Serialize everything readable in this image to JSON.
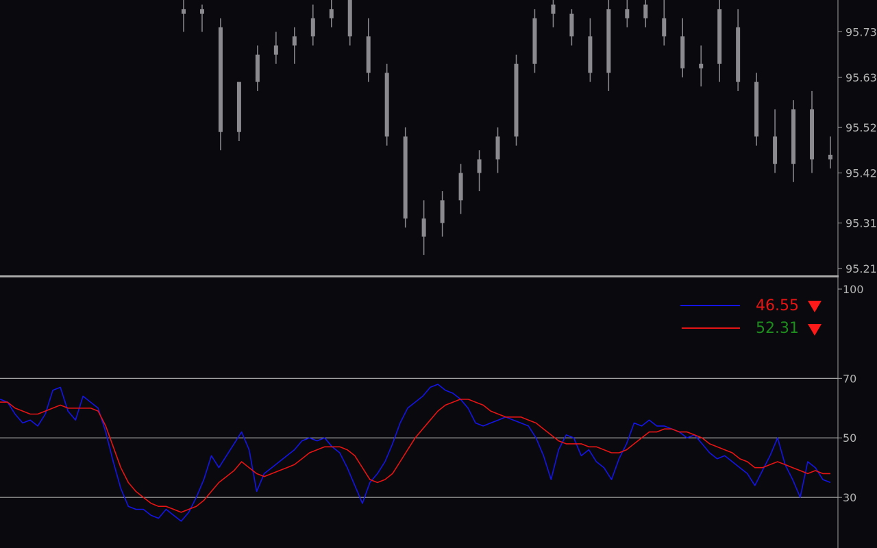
{
  "colors": {
    "background": "#0a0a0e",
    "axis_text": "#b4b4b4",
    "candle": "#8a8a8f",
    "level_line": "#a3a3a3",
    "separator": "#a9a9a9",
    "main_line": "#1414e6",
    "signal_line": "#e61414",
    "value_red": "#e61414",
    "value_green": "#1e8c1e",
    "arrow_red": "#ff1a1a"
  },
  "chart_data": [
    {
      "type": "candlestick",
      "title": "",
      "y_axis_side": "right",
      "ylim": [
        95.195,
        95.8
      ],
      "y_ticks": [
        "95.73",
        "95.63",
        "95.52",
        "95.42",
        "95.31",
        "95.21"
      ],
      "y_tick_values": [
        95.73,
        95.63,
        95.52,
        95.42,
        95.31,
        95.21
      ],
      "candles": [
        {
          "o": 95.78,
          "h": 95.8,
          "l": 95.73,
          "c": 95.77
        },
        {
          "o": 95.77,
          "h": 95.79,
          "l": 95.73,
          "c": 95.78
        },
        {
          "o": 95.74,
          "h": 95.76,
          "l": 95.47,
          "c": 95.51
        },
        {
          "o": 95.51,
          "h": 95.58,
          "l": 95.49,
          "c": 95.62
        },
        {
          "o": 95.62,
          "h": 95.7,
          "l": 95.6,
          "c": 95.68
        },
        {
          "o": 95.68,
          "h": 95.73,
          "l": 95.66,
          "c": 95.7
        },
        {
          "o": 95.7,
          "h": 95.74,
          "l": 95.66,
          "c": 95.72
        },
        {
          "o": 95.72,
          "h": 95.79,
          "l": 95.7,
          "c": 95.76
        },
        {
          "o": 95.76,
          "h": 95.8,
          "l": 95.74,
          "c": 95.78
        },
        {
          "o": 95.8,
          "h": 95.8,
          "l": 95.7,
          "c": 95.72
        },
        {
          "o": 95.72,
          "h": 95.76,
          "l": 95.62,
          "c": 95.64
        },
        {
          "o": 95.64,
          "h": 95.66,
          "l": 95.48,
          "c": 95.5
        },
        {
          "o": 95.5,
          "h": 95.52,
          "l": 95.3,
          "c": 95.32
        },
        {
          "o": 95.32,
          "h": 95.36,
          "l": 95.24,
          "c": 95.28
        },
        {
          "o": 95.31,
          "h": 95.38,
          "l": 95.28,
          "c": 95.36
        },
        {
          "o": 95.36,
          "h": 95.44,
          "l": 95.33,
          "c": 95.42
        },
        {
          "o": 95.42,
          "h": 95.47,
          "l": 95.38,
          "c": 95.45
        },
        {
          "o": 95.45,
          "h": 95.52,
          "l": 95.42,
          "c": 95.5
        },
        {
          "o": 95.5,
          "h": 95.68,
          "l": 95.48,
          "c": 95.66
        },
        {
          "o": 95.66,
          "h": 95.78,
          "l": 95.64,
          "c": 95.76
        },
        {
          "o": 95.79,
          "h": 95.8,
          "l": 95.74,
          "c": 95.77
        },
        {
          "o": 95.77,
          "h": 95.78,
          "l": 95.7,
          "c": 95.72
        },
        {
          "o": 95.72,
          "h": 95.76,
          "l": 95.62,
          "c": 95.64
        },
        {
          "o": 95.64,
          "h": 95.8,
          "l": 95.6,
          "c": 95.78
        },
        {
          "o": 95.78,
          "h": 95.8,
          "l": 95.74,
          "c": 95.76
        },
        {
          "o": 95.79,
          "h": 95.8,
          "l": 95.74,
          "c": 95.76
        },
        {
          "o": 95.76,
          "h": 95.8,
          "l": 95.7,
          "c": 95.72
        },
        {
          "o": 95.72,
          "h": 95.76,
          "l": 95.63,
          "c": 95.65
        },
        {
          "o": 95.65,
          "h": 95.7,
          "l": 95.61,
          "c": 95.66
        },
        {
          "o": 95.66,
          "h": 95.8,
          "l": 95.62,
          "c": 95.78
        },
        {
          "o": 95.74,
          "h": 95.78,
          "l": 95.6,
          "c": 95.62
        },
        {
          "o": 95.62,
          "h": 95.64,
          "l": 95.48,
          "c": 95.5
        },
        {
          "o": 95.5,
          "h": 95.56,
          "l": 95.42,
          "c": 95.44
        },
        {
          "o": 95.44,
          "h": 95.58,
          "l": 95.4,
          "c": 95.56
        },
        {
          "o": 95.56,
          "h": 95.6,
          "l": 95.42,
          "c": 95.45
        },
        {
          "o": 95.45,
          "h": 95.5,
          "l": 95.43,
          "c": 95.46
        }
      ]
    },
    {
      "type": "line",
      "title": "",
      "y_axis_side": "right",
      "ylim": [
        13,
        100
      ],
      "y_ticks": [
        "100",
        "70",
        "50",
        "30"
      ],
      "y_tick_values": [
        100,
        70,
        50,
        30
      ],
      "levels": [
        70,
        50,
        30
      ],
      "series": [
        {
          "color": "#1414e6",
          "last_value": "46.55",
          "values": [
            63,
            62,
            58,
            55,
            56,
            54,
            58,
            66,
            67,
            59,
            56,
            64,
            62,
            60,
            52,
            42,
            33,
            27,
            26,
            26,
            24,
            23,
            26,
            24,
            22,
            25,
            30,
            36,
            44,
            40,
            44,
            48,
            52,
            46,
            32,
            38,
            40,
            42,
            44,
            46,
            49,
            50,
            49,
            50,
            47,
            45,
            40,
            34,
            28,
            35,
            38,
            42,
            48,
            55,
            60,
            62,
            64,
            67,
            68,
            66,
            65,
            63,
            60,
            55,
            54,
            55,
            56,
            57,
            56,
            55,
            54,
            50,
            44,
            36,
            46,
            51,
            50,
            44,
            46,
            42,
            40,
            36,
            43,
            48,
            55,
            54,
            56,
            54,
            54,
            53,
            52,
            50,
            51,
            48,
            45,
            43,
            44,
            42,
            40,
            38,
            34,
            39,
            44,
            50,
            41,
            36,
            30,
            42,
            40,
            36,
            35
          ]
        },
        {
          "color": "#e61414",
          "last_value": "52.31",
          "values": [
            62,
            62,
            60,
            59,
            58,
            58,
            59,
            60,
            61,
            60,
            60,
            60,
            60,
            59,
            54,
            47,
            40,
            35,
            32,
            30,
            28,
            27,
            27,
            26,
            25,
            26,
            27,
            29,
            32,
            35,
            37,
            39,
            42,
            40,
            38,
            37,
            38,
            39,
            40,
            41,
            43,
            45,
            46,
            47,
            47,
            47,
            46,
            44,
            40,
            36,
            35,
            36,
            38,
            42,
            46,
            50,
            53,
            56,
            59,
            61,
            62,
            63,
            63,
            62,
            61,
            59,
            58,
            57,
            57,
            57,
            56,
            55,
            53,
            51,
            49,
            48,
            48,
            48,
            47,
            47,
            46,
            45,
            45,
            46,
            48,
            50,
            52,
            52,
            53,
            53,
            52,
            52,
            51,
            50,
            48,
            47,
            46,
            45,
            43,
            42,
            40,
            40,
            41,
            42,
            41,
            40,
            39,
            38,
            39,
            38,
            38
          ]
        }
      ],
      "legend": [
        {
          "value": "46.55",
          "value_color": "#e61414",
          "arrow": "down-triangle-icon"
        },
        {
          "value": "52.31",
          "value_color": "#1e8c1e",
          "arrow": "down-triangle-icon"
        }
      ]
    }
  ]
}
